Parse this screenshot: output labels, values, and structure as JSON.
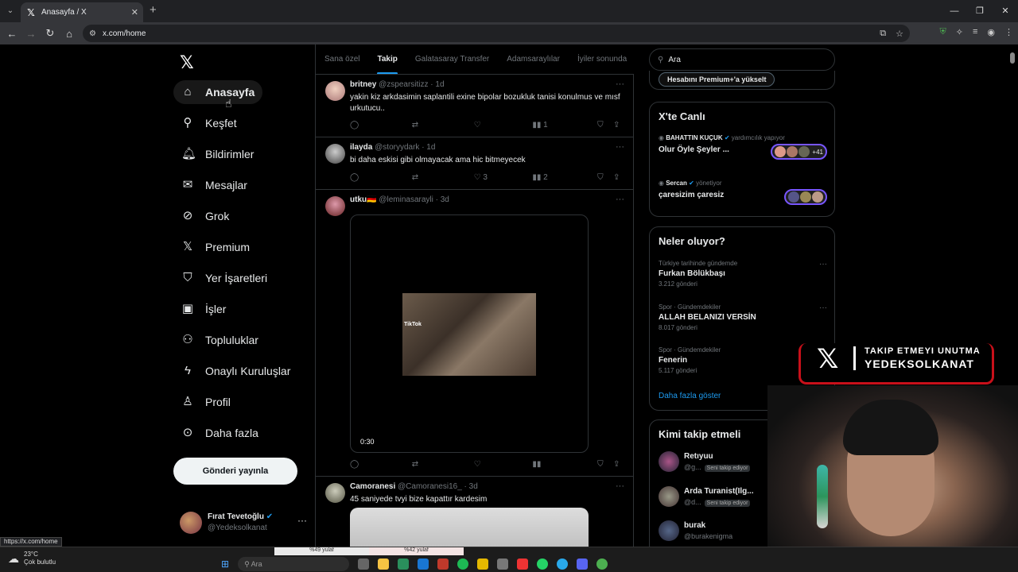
{
  "browser": {
    "tab_title": "Anasayfa / X",
    "url": "x.com/home",
    "status_url": "https://x.com/home"
  },
  "nav": {
    "items": [
      {
        "label": "Anasayfa",
        "icon": "home-icon"
      },
      {
        "label": "Keşfet",
        "icon": "search-icon"
      },
      {
        "label": "Bildirimler",
        "icon": "bell-icon"
      },
      {
        "label": "Mesajlar",
        "icon": "mail-icon"
      },
      {
        "label": "Grok",
        "icon": "grok-icon"
      },
      {
        "label": "Premium",
        "icon": "x-logo-icon"
      },
      {
        "label": "Yer İşaretleri",
        "icon": "bookmark-icon"
      },
      {
        "label": "İşler",
        "icon": "briefcase-icon"
      },
      {
        "label": "Topluluklar",
        "icon": "people-icon"
      },
      {
        "label": "Onaylı Kuruluşlar",
        "icon": "lightning-icon"
      },
      {
        "label": "Profil",
        "icon": "person-icon"
      },
      {
        "label": "Daha fazla",
        "icon": "more-circle-icon"
      }
    ],
    "post_button": "Gönderi yayınla",
    "account": {
      "name": "Fırat Tevetoğlu",
      "handle": "@Yedeksolkanat"
    }
  },
  "feed": {
    "tabs": [
      "Sana özel",
      "Takip",
      "Galatasaray Transfer",
      "Adamsaraylılar",
      "İyiler sonunda"
    ],
    "active_tab": "Takip",
    "posts": [
      {
        "name": "britney",
        "handle": "@zspearsitizz · 1d",
        "text": "yakin kiz arkdasimin saplantili exine bipolar bozukluk tanisi konulmus ve mısf urkutucu..",
        "likes": "",
        "views": "1"
      },
      {
        "name": "ilayda",
        "handle": "@storyydark · 1d",
        "text": "bi daha eskisi gibi olmayacak ama hic bitmeyecek",
        "likes": "3",
        "views": "2"
      },
      {
        "name": "utku🇩🇪",
        "handle": "@leminasarayli · 3d",
        "text": "",
        "video_time": "0:30",
        "tiktok_label": "TikTok"
      },
      {
        "name": "Camoranesi",
        "handle": "@Camoranesi16_ · 3d",
        "text": "45 saniyede tvyi bize kapattır kardesim"
      }
    ]
  },
  "sidebar": {
    "search_placeholder": "Ara",
    "premium_button": "Hesabını Premium+'a yükselt",
    "live_title": "X'te Canlı",
    "live": [
      {
        "host": "BAHATTIN KUÇUK",
        "role": "yardımcılık yapıyor",
        "title": "Olur Öyle Şeyler ...",
        "extra": "+41"
      },
      {
        "host": "Sercan",
        "role": "yönetiyor",
        "title": "çaresizim çaresiz",
        "extra": ""
      }
    ],
    "trends_title": "Neler oluyor?",
    "trends": [
      {
        "category": "Türkiye tarihinde gündemde",
        "title": "Furkan Bölükbaşı",
        "count": "3.212 gönderi"
      },
      {
        "category": "Spor · Gündemdekiler",
        "title": "ALLAH BELANIZI VERSİN",
        "count": "8.017 gönderi"
      },
      {
        "category": "Spor · Gündemdekiler",
        "title": "Fenerin",
        "count": "5.117 gönderi"
      }
    ],
    "show_more": "Daha fazla göster",
    "follow_title": "Kimi takip etmeli",
    "follow": [
      {
        "name": "Retıyuu",
        "handle": "@g...",
        "badge": "Seni takip ediyor"
      },
      {
        "name": "Arda Turanist(Ilg...",
        "handle": "@d...",
        "badge": "Seni takip ediyor"
      },
      {
        "name": "burak",
        "handle": "@burakenigma",
        "badge": ""
      }
    ]
  },
  "overlay": {
    "line1": "TAKIP ETMEYI UNUTMA",
    "line2": "YEDEKSOLKANAT"
  },
  "taskbar": {
    "temp": "23°C",
    "weather": "Çok bulutlu",
    "search": "Ara",
    "ticker": [
      "%49 yulaf",
      "%42 yulaf"
    ]
  },
  "colors": {
    "accent": "#1d9bf0",
    "background": "#000000",
    "border": "#2f3336"
  }
}
